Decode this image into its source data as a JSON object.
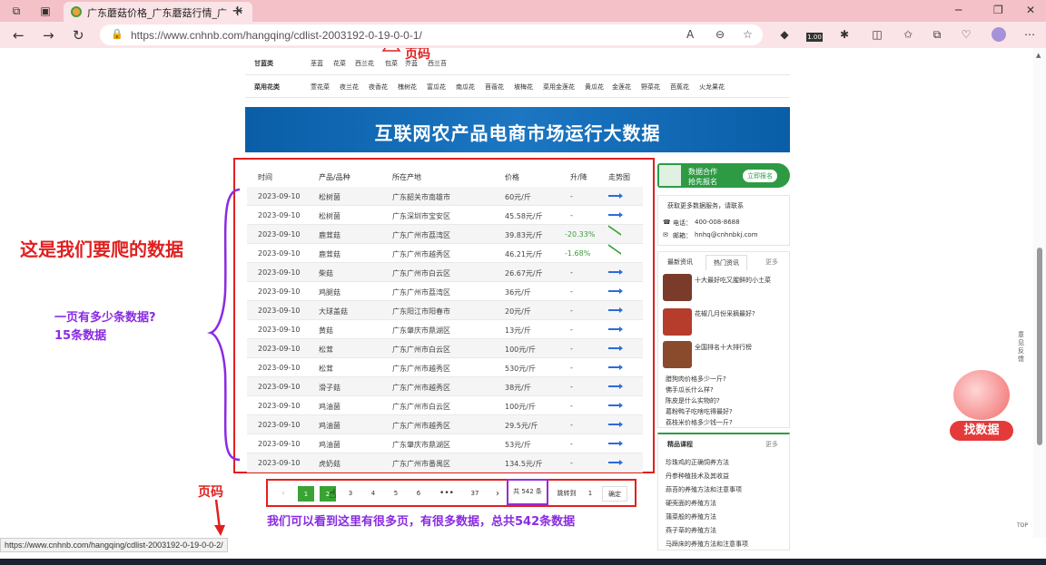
{
  "browser": {
    "tab_title": "广东蘑菇价格_广东蘑菇行情_广",
    "url": "https://www.cnhnb.com/hangqing/cdlist-2003192-0-19-0-0-1/",
    "ext_badge": "1.00"
  },
  "categories": {
    "row1_label": "甘蓝类",
    "row1_items": [
      "茎蓝",
      "花菜",
      "西兰花",
      "包菜",
      "芥蓝",
      "西兰苔"
    ],
    "row2_label": "菜用花类",
    "row2_items": [
      "萱花菜",
      "夜兰花",
      "夜香花",
      "槐树花",
      "富瓜花",
      "南瓜花",
      "苜蓿花",
      "坡梅花",
      "菜用金莲花",
      "黄瓜花",
      "金莲花",
      "野菜花",
      "芭蕉花",
      "火龙果花"
    ]
  },
  "banner": {
    "title": "互联网农产品电商市场运行大数据"
  },
  "table": {
    "headers": [
      "时间",
      "产品/品种",
      "所在产地",
      "价格",
      "升/降",
      "走势图"
    ],
    "rows": [
      {
        "date": "2023-09-10",
        "product": "松树菌",
        "origin": "广东韶关市南雄市",
        "price": "60元/斤",
        "change": "-",
        "trend": "up"
      },
      {
        "date": "2023-09-10",
        "product": "松树菌",
        "origin": "广东深圳市宝安区",
        "price": "45.58元/斤",
        "change": "-",
        "trend": "up"
      },
      {
        "date": "2023-09-10",
        "product": "鹿茸菇",
        "origin": "广东广州市荔湾区",
        "price": "39.83元/斤",
        "change": "-20.33%",
        "trend": "down"
      },
      {
        "date": "2023-09-10",
        "product": "鹿茸菇",
        "origin": "广东广州市越秀区",
        "price": "46.21元/斤",
        "change": "-1.68%",
        "trend": "down"
      },
      {
        "date": "2023-09-10",
        "product": "柴菇",
        "origin": "广东广州市白云区",
        "price": "26.67元/斤",
        "change": "-",
        "trend": "up"
      },
      {
        "date": "2023-09-10",
        "product": "鸡腿菇",
        "origin": "广东广州市荔湾区",
        "price": "36元/斤",
        "change": "-",
        "trend": "up"
      },
      {
        "date": "2023-09-10",
        "product": "大球盖菇",
        "origin": "广东阳江市阳春市",
        "price": "20元/斤",
        "change": "-",
        "trend": "up"
      },
      {
        "date": "2023-09-10",
        "product": "黄菇",
        "origin": "广东肇庆市鼎湖区",
        "price": "13元/斤",
        "change": "-",
        "trend": "up"
      },
      {
        "date": "2023-09-10",
        "product": "松茸",
        "origin": "广东广州市白云区",
        "price": "100元/斤",
        "change": "-",
        "trend": "up"
      },
      {
        "date": "2023-09-10",
        "product": "松茸",
        "origin": "广东广州市越秀区",
        "price": "530元/斤",
        "change": "-",
        "trend": "up"
      },
      {
        "date": "2023-09-10",
        "product": "滑子菇",
        "origin": "广东广州市越秀区",
        "price": "38元/斤",
        "change": "-",
        "trend": "up"
      },
      {
        "date": "2023-09-10",
        "product": "鸡油菌",
        "origin": "广东广州市白云区",
        "price": "100元/斤",
        "change": "-",
        "trend": "up"
      },
      {
        "date": "2023-09-10",
        "product": "鸡油菌",
        "origin": "广东广州市越秀区",
        "price": "29.5元/斤",
        "change": "-",
        "trend": "up"
      },
      {
        "date": "2023-09-10",
        "product": "鸡油菌",
        "origin": "广东肇庆市鼎湖区",
        "price": "53元/斤",
        "change": "-",
        "trend": "up"
      },
      {
        "date": "2023-09-10",
        "product": "虎奶菇",
        "origin": "广东广州市番禺区",
        "price": "134.5元/斤",
        "change": "-",
        "trend": "up"
      }
    ]
  },
  "pager": {
    "prev": "‹",
    "pages": [
      "1",
      "2",
      "3",
      "4",
      "5",
      "6",
      "•••",
      "37"
    ],
    "current": "2",
    "next": "›",
    "total": "共 542 条",
    "goto_label": "跳转到",
    "goto_value": "1",
    "confirm": "确定"
  },
  "sidebar": {
    "promo_title": "数据合作",
    "promo_sub": "抢先报名",
    "promo_btn": "立即报名",
    "contact_title": "获取更多数据服务，请联系",
    "phone_label": "电话：",
    "phone": "400-008-8688",
    "email_label": "邮箱：",
    "email": "hnhq@cnhnbkj.com",
    "tab_latest": "最新资讯",
    "tab_hot": "热门资讯",
    "more": "更多",
    "news": [
      "十大最好吃又腥鲜的小土菜",
      "花椒几月份采摘最好?",
      "全国排名十大排行榜"
    ],
    "list": [
      "腊狗肉价格多少一斤?",
      "佛手瓜长什么样?",
      "陈皮是什么实物的?",
      "葛粉鸭子吃啥吃得最好?",
      "荔枝米价格多少钱一斤?"
    ],
    "course_tab": "精品课程",
    "courses": [
      "珍珠鸡的正确饲养方法",
      "丹参种植技术及其收益",
      "蒜苔的养殖方法和注意事项",
      "硬壳面的养殖方法",
      "蒲菜般的养殖方法",
      "燕子草的养殖方法",
      "马蹄床的养殖方法和注意事项"
    ],
    "side_float": "意见反馈",
    "find_data": "找数据",
    "top": "TOP"
  },
  "annotations": {
    "page_code_top": "页码",
    "main_note": "这是我们要爬的数据",
    "count_q": "一页有多少条数据?",
    "count_a": "15条数据",
    "page_code_bottom": "页码",
    "bottom_note": "我们可以看到这里有很多页，有很多数据，总共542条数据"
  },
  "status_url": "https://www.cnhnb.com/hangqing/cdlist-2003192-0-19-0-0-2/"
}
